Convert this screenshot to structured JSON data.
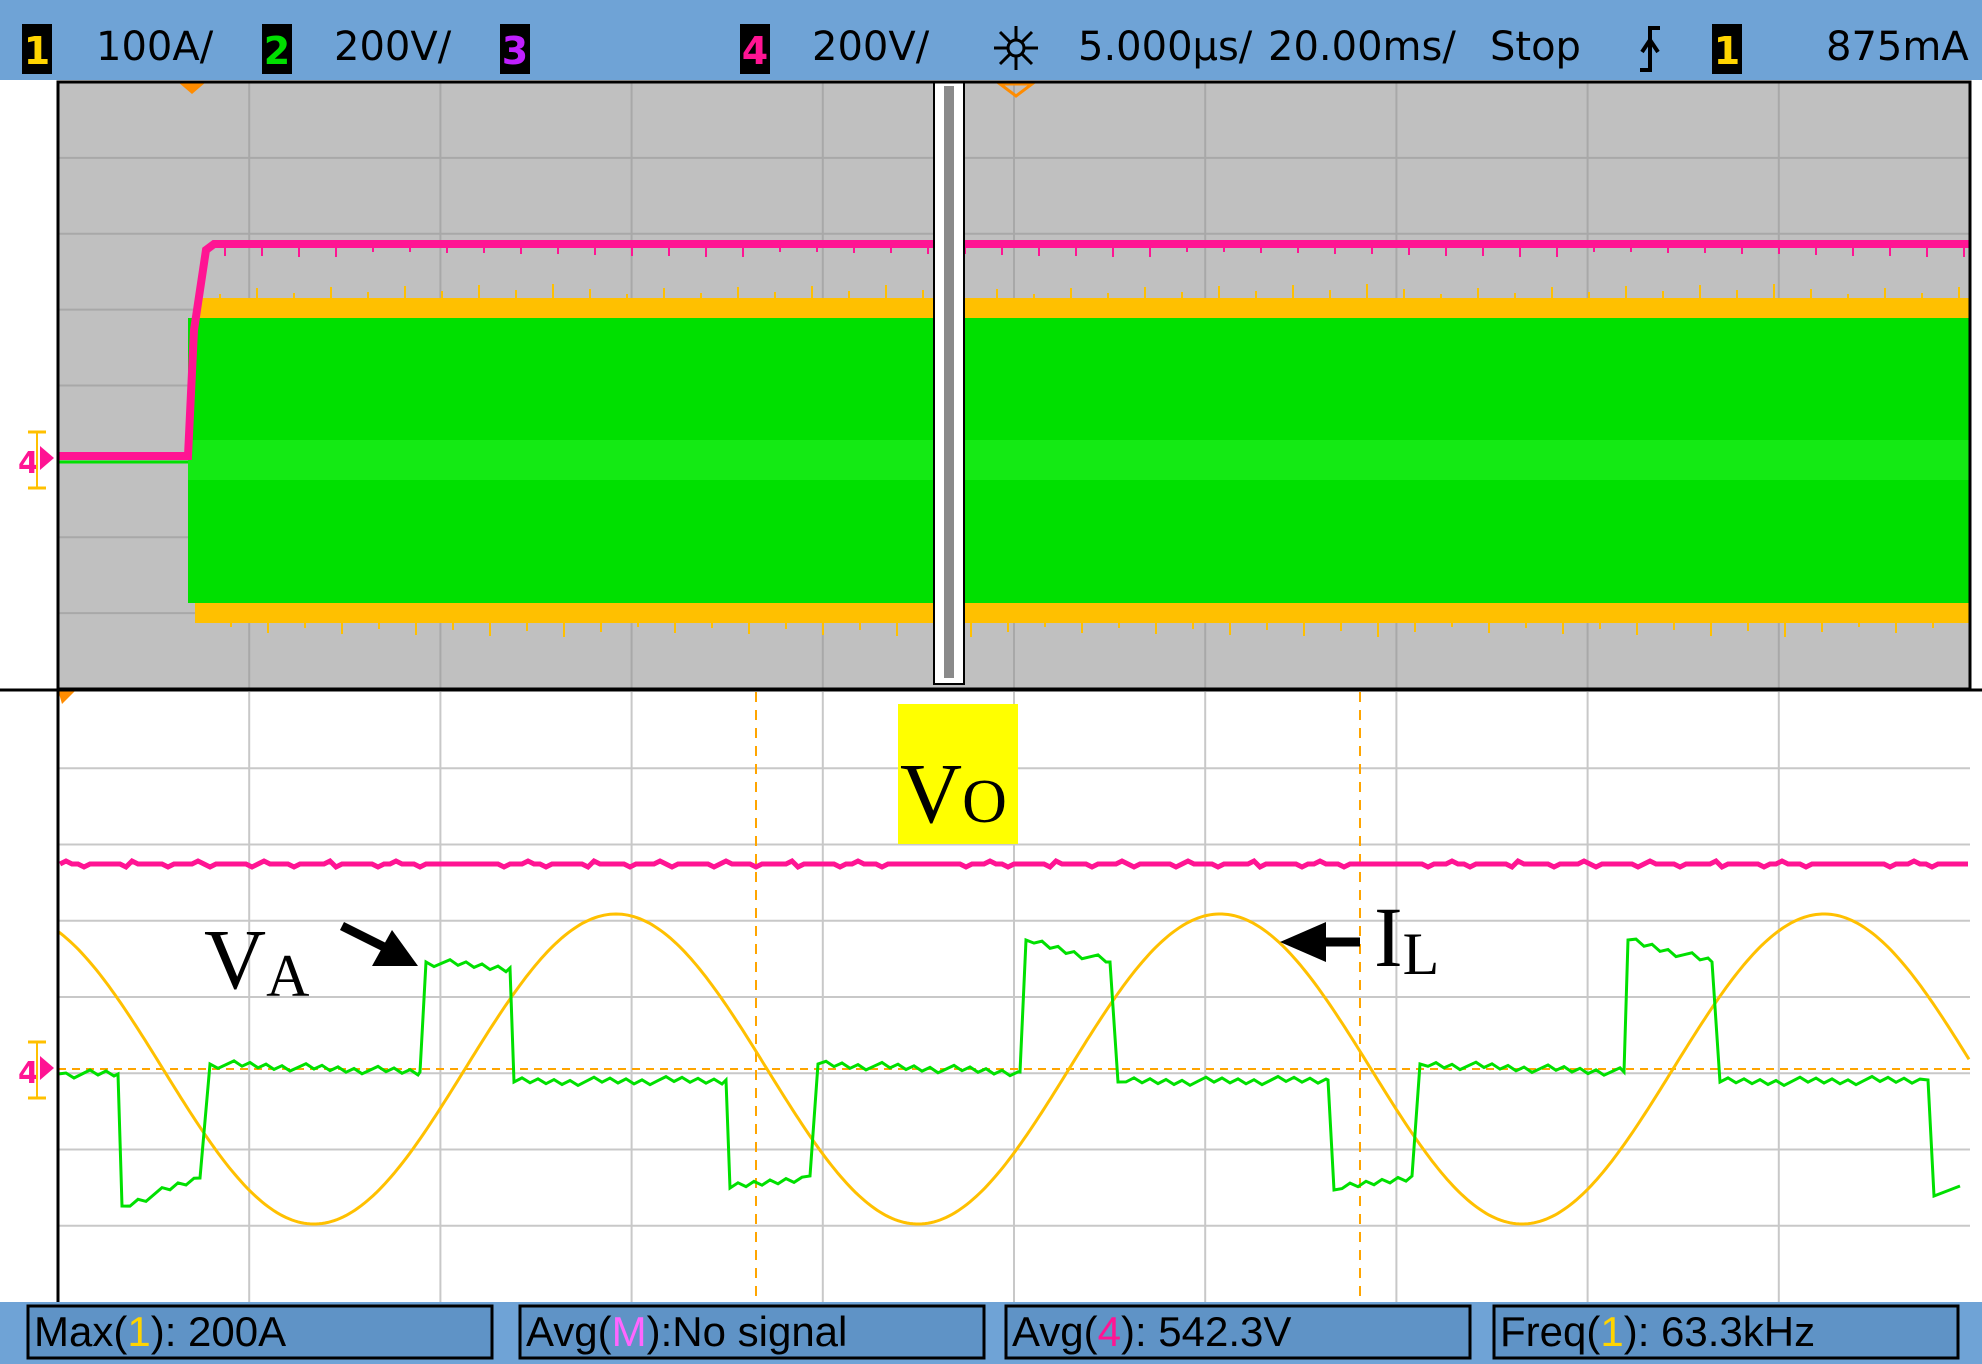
{
  "status_bar": {
    "ch1": {
      "num": "1",
      "scale": "100A/",
      "color": "#FFD400"
    },
    "ch2": {
      "num": "2",
      "scale": "200V/",
      "color": "#00E000"
    },
    "ch3": {
      "num": "3",
      "scale": "",
      "color": "#C020FF"
    },
    "ch4": {
      "num": "4",
      "scale": "200V/",
      "color": "#FF1493"
    },
    "timebase": "5.000µs/",
    "delay": "20.00ms/",
    "run_state": "Stop",
    "trigger_channel": "1",
    "trigger_level": "875mA"
  },
  "annotations": {
    "vo": {
      "main": "V",
      "sub": "O"
    },
    "va": {
      "main": "V",
      "sub": "A"
    },
    "il": {
      "main": "I",
      "sub": "L"
    }
  },
  "measurements": [
    {
      "pre": "Max(",
      "ch": "1",
      "post": "): 200A",
      "ch_color": "#FFD400"
    },
    {
      "pre": "Avg(",
      "ch": "M",
      "post": "):No signal",
      "ch_color": "#FF66FF"
    },
    {
      "pre": "Avg(",
      "ch": "4",
      "post": "): 542.3V",
      "ch_color": "#FF1493"
    },
    {
      "pre": "Freq(",
      "ch": "1",
      "post": "): 63.3kHz",
      "ch_color": "#FFD400"
    }
  ],
  "colors": {
    "header_bg": "#6FA3D6",
    "trace_current": "#FFC000",
    "trace_va": "#00E000",
    "trace_vo": "#FF1493",
    "overview_bg": "#C0C0C0",
    "highlight": "#FFFF00"
  },
  "icons": {
    "acquire": "sparkle-icon",
    "trigger": "trigger-edge-icon",
    "ground_marker": "ground-marker-icon"
  }
}
